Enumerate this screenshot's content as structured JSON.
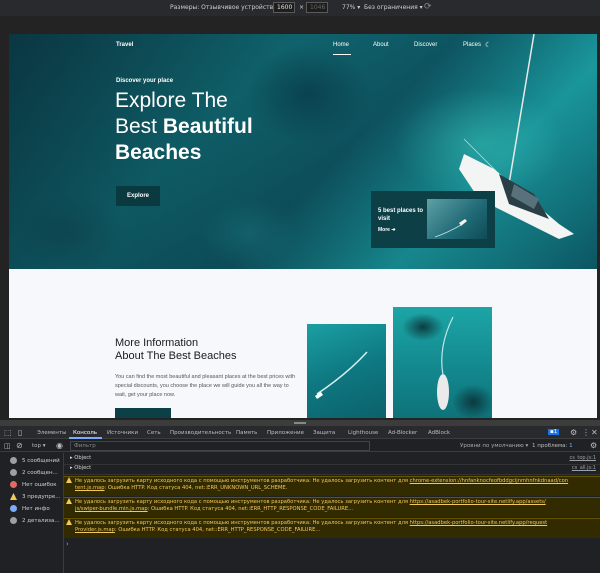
{
  "device_toolbar": {
    "dimensions_label": "Размеры: Отзывчивое устройство",
    "width": "1600",
    "x_sep": "×",
    "height": "1046",
    "zoom": "77%",
    "throttle": "Без ограничения"
  },
  "site": {
    "brand": "Travel",
    "nav": [
      "Home",
      "About",
      "Discover",
      "Places"
    ],
    "hero": {
      "subtitle": "Discover your place",
      "title_line1": "Explore The",
      "title_line2_plain": "Best ",
      "title_line2_bold": "Beautiful",
      "title_line3": "Beaches",
      "button": "Explore"
    },
    "card": {
      "title": "5 best places to visit",
      "more": "More"
    },
    "section2": {
      "title_line1": "More Information",
      "title_line2": "About The Best Beaches",
      "text": "You can find the most beautiful and pleasant places at the best prices with special discounts, you choose the place we will guide you all the way to wait, get your place now."
    }
  },
  "devtools": {
    "tabs": [
      "Элементы",
      "Консоль",
      "Источники",
      "Сеть",
      "Производительность",
      "Память",
      "Приложение",
      "Защита",
      "Lighthouse",
      "Ad-Blocker",
      "AdBlock"
    ],
    "active_tab": "Консоль",
    "badge_count": "1",
    "filter": {
      "context": "top",
      "placeholder": "Фильтр",
      "levels": "Уровни по умолчанию",
      "issues": "1 проблема:",
      "issues_count": "1"
    },
    "sidebar": [
      {
        "label": "5 сообщений",
        "color": "#9aa0a6"
      },
      {
        "label": "2 сообщен...",
        "color": "#9aa0a6"
      },
      {
        "label": "Нет ошибок",
        "color": "#e46962"
      },
      {
        "label": "3 предупре...",
        "color": "#f2c85b"
      },
      {
        "label": "Нет инфо",
        "color": "#7cacf8"
      },
      {
        "label": "2 детализа...",
        "color": "#9aa0a6"
      }
    ],
    "logs": [
      {
        "text": "Object",
        "source": "cs_top.js:1"
      },
      {
        "text": "Object",
        "source": "cs_all.js:1"
      }
    ],
    "warnings": [
      {
        "line1": "Не удалось загрузить карту исходного кода с помощью инструментов разработчика: Не удалось загрузить контент для ",
        "link1": "chrome-extension://hnfanknocfeofbddgcijnmhnfnkdnaad/con",
        "line2_link": "tent.js.map",
        "line2": ": Ошибка HTTP. Код статуса 404, net::ERR_UNKNOWN_URL_SCHEME."
      },
      {
        "line1": "Не удалось загрузить карту исходного кода с помощью инструментов разработчика: Не удалось загрузить контент для ",
        "link1": "https://asadbek-portfolio-tour-site.netlify.app/assets/",
        "line2_link": "js/swiper-bundle.min.js.map",
        "line2": ": Ошибка HTTP. Код статуса 404, net::ERR_HTTP_RESPONSE_CODE_FAILURE..."
      },
      {
        "line1": "Не удалось загрузить карту исходного кода с помощью инструментов разработчика: Не удалось загрузить контент для ",
        "link1": "https://asadbek-portfolio-tour-site.netlify.app/request",
        "line2_link": "Provider.js.map",
        "line2": ": Ошибка HTTP. Код статуса 404, net::ERR_HTTP_RESPONSE_CODE_FAILURE..."
      }
    ],
    "prompt": "›"
  }
}
